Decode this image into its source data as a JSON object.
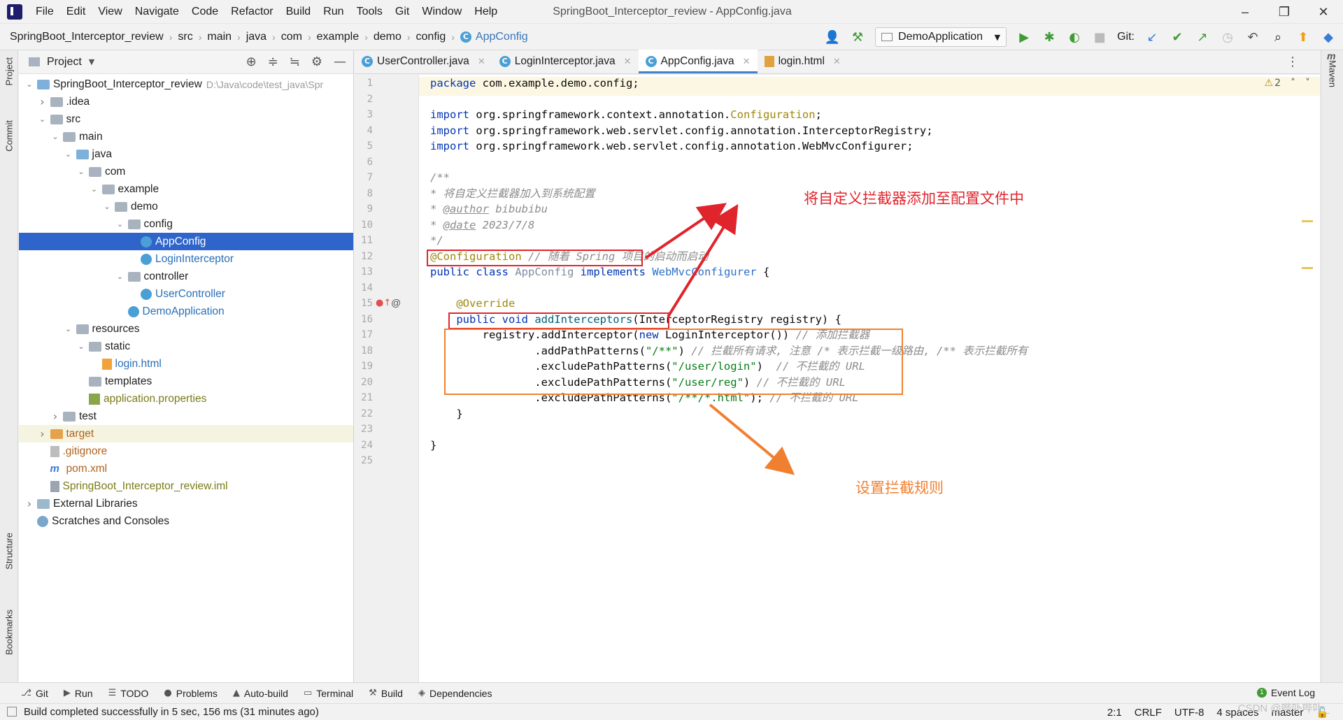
{
  "menubar": {
    "items": [
      "File",
      "Edit",
      "View",
      "Navigate",
      "Code",
      "Refactor",
      "Build",
      "Run",
      "Tools",
      "Git",
      "Window",
      "Help"
    ],
    "window_title": "SpringBoot_Interceptor_review - AppConfig.java"
  },
  "navbar": {
    "breadcrumb": [
      "SpringBoot_Interceptor_review",
      "src",
      "main",
      "java",
      "com",
      "example",
      "demo",
      "config"
    ],
    "current": "AppConfig",
    "run_config": "DemoApplication",
    "git_label": "Git:"
  },
  "left_strip": {
    "tabs": [
      "Project",
      "Commit",
      "Structure",
      "Bookmarks"
    ]
  },
  "project_panel": {
    "title": "Project",
    "tree": [
      {
        "label": "SpringBoot_Interceptor_review",
        "hint": "D:\\Java\\code\\test_java\\Spr",
        "indent": 0,
        "arrow": "v",
        "icon": "folder-blue",
        "style": "bold"
      },
      {
        "label": ".idea",
        "indent": 1,
        "arrow": ">",
        "icon": "folder",
        "style": ""
      },
      {
        "label": "src",
        "indent": 1,
        "arrow": "v",
        "icon": "folder",
        "style": ""
      },
      {
        "label": "main",
        "indent": 2,
        "arrow": "v",
        "icon": "folder",
        "style": ""
      },
      {
        "label": "java",
        "indent": 3,
        "arrow": "v",
        "icon": "folder-blue",
        "style": ""
      },
      {
        "label": "com",
        "indent": 4,
        "arrow": "v",
        "icon": "folder",
        "style": ""
      },
      {
        "label": "example",
        "indent": 5,
        "arrow": "v",
        "icon": "folder",
        "style": ""
      },
      {
        "label": "demo",
        "indent": 6,
        "arrow": "v",
        "icon": "folder",
        "style": ""
      },
      {
        "label": "config",
        "indent": 7,
        "arrow": "v",
        "icon": "folder",
        "style": ""
      },
      {
        "label": "AppConfig",
        "indent": 8,
        "arrow": "",
        "icon": "class",
        "style": "selected"
      },
      {
        "label": "LoginInterceptor",
        "indent": 8,
        "arrow": "",
        "icon": "class",
        "style": "blue"
      },
      {
        "label": "controller",
        "indent": 7,
        "arrow": "v",
        "icon": "folder",
        "style": ""
      },
      {
        "label": "UserController",
        "indent": 8,
        "arrow": "",
        "icon": "class",
        "style": "blue"
      },
      {
        "label": "DemoApplication",
        "indent": 7,
        "arrow": "",
        "icon": "class",
        "style": "blue"
      },
      {
        "label": "resources",
        "indent": 3,
        "arrow": "v",
        "icon": "folder",
        "style": ""
      },
      {
        "label": "static",
        "indent": 4,
        "arrow": "v",
        "icon": "folder",
        "style": ""
      },
      {
        "label": "login.html",
        "indent": 5,
        "arrow": "",
        "icon": "html",
        "style": "blue"
      },
      {
        "label": "templates",
        "indent": 4,
        "arrow": "",
        "icon": "folder",
        "style": ""
      },
      {
        "label": "application.properties",
        "indent": 4,
        "arrow": "",
        "icon": "prop",
        "style": "olive"
      },
      {
        "label": "test",
        "indent": 2,
        "arrow": ">",
        "icon": "folder",
        "style": ""
      },
      {
        "label": "target",
        "indent": 1,
        "arrow": ">",
        "icon": "folder-orange",
        "style": "orange"
      },
      {
        "label": ".gitignore",
        "indent": 1,
        "arrow": "",
        "icon": "git",
        "style": "orange"
      },
      {
        "label": "pom.xml",
        "indent": 1,
        "arrow": "",
        "icon": "m",
        "style": "orange"
      },
      {
        "label": "SpringBoot_Interceptor_review.iml",
        "indent": 1,
        "arrow": "",
        "icon": "iml",
        "style": "olive"
      },
      {
        "label": "External Libraries",
        "indent": 0,
        "arrow": ">",
        "icon": "lib",
        "style": ""
      },
      {
        "label": "Scratches and Consoles",
        "indent": 0,
        "arrow": "",
        "icon": "scratch",
        "style": ""
      }
    ]
  },
  "editor": {
    "tabs": [
      {
        "label": "UserController.java",
        "icon": "class",
        "active": false
      },
      {
        "label": "LoginInterceptor.java",
        "icon": "class",
        "active": false
      },
      {
        "label": "AppConfig.java",
        "icon": "class",
        "active": true
      },
      {
        "label": "login.html",
        "icon": "html",
        "active": false
      }
    ],
    "warnings": "2",
    "line_numbers": [
      "1",
      "2",
      "3",
      "4",
      "5",
      "6",
      "7",
      "8",
      "9",
      "10",
      "11",
      "12",
      "13",
      "14",
      "15",
      "16",
      "17",
      "18",
      "19",
      "20",
      "21",
      "22",
      "23",
      "24",
      "25"
    ],
    "lines": [
      [
        [
          "kw",
          "package "
        ],
        [
          "plain",
          "com.example.demo.config;"
        ]
      ],
      [],
      [
        [
          "kw",
          "import "
        ],
        [
          "plain",
          "org.springframework.context.annotation."
        ],
        [
          "ann",
          "Configuration"
        ],
        [
          "plain",
          ";"
        ]
      ],
      [
        [
          "kw",
          "import "
        ],
        [
          "plain",
          "org.springframework.web.servlet.config.annotation.InterceptorRegistry;"
        ]
      ],
      [
        [
          "kw",
          "import "
        ],
        [
          "plain",
          "org.springframework.web.servlet.config.annotation.WebMvcConfigurer;"
        ]
      ],
      [],
      [
        [
          "cmt",
          "/**"
        ]
      ],
      [
        [
          "cmt",
          "* 将自定义拦截器加入到系统配置"
        ]
      ],
      [
        [
          "cmt",
          "* "
        ],
        [
          "tag",
          "@author"
        ],
        [
          "cmt",
          " bibubibu"
        ]
      ],
      [
        [
          "cmt",
          "* "
        ],
        [
          "tag",
          "@date"
        ],
        [
          "cmt",
          " 2023/7/8"
        ]
      ],
      [
        [
          "cmt",
          "*/"
        ]
      ],
      [
        [
          "ann",
          "@Configuration"
        ],
        [
          "cmt",
          " // 随着 Spring 项目的启动而启动"
        ]
      ],
      [
        [
          "kw",
          "public class "
        ],
        [
          "muted-id",
          "AppConfig "
        ],
        [
          "kw",
          "implements "
        ],
        [
          "iface",
          "WebMvcConfigurer"
        ],
        [
          "plain",
          " {"
        ]
      ],
      [],
      [
        [
          "ann",
          "    @Override"
        ]
      ],
      [
        [
          "kw",
          "    public void "
        ],
        [
          "fn",
          "addInterceptors"
        ],
        [
          "plain",
          "(InterceptorRegistry registry) {"
        ]
      ],
      [
        [
          "plain",
          "        registry."
        ],
        [
          "plain",
          "addInterceptor("
        ],
        [
          "kw",
          "new "
        ],
        [
          "plain",
          "LoginInterceptor())"
        ],
        [
          "cmt",
          " // 添加拦截器"
        ]
      ],
      [
        [
          "plain",
          "                .addPathPatterns("
        ],
        [
          "str",
          "\"/**\""
        ],
        [
          "plain",
          ") "
        ],
        [
          "cmt",
          "// 拦截所有请求, 注意 /* 表示拦截一级路由, /** 表示拦截所有"
        ]
      ],
      [
        [
          "plain",
          "                .excludePathPatterns("
        ],
        [
          "str",
          "\"/user/login\""
        ],
        [
          "plain",
          ")  "
        ],
        [
          "cmt",
          "// 不拦截的 URL"
        ]
      ],
      [
        [
          "plain",
          "                .excludePathPatterns("
        ],
        [
          "str",
          "\"/user/reg\""
        ],
        [
          "plain",
          ") "
        ],
        [
          "cmt",
          "// 不拦截的 URL"
        ]
      ],
      [
        [
          "plain",
          "                .excludePathPatterns("
        ],
        [
          "str",
          "\"/**/*.html\""
        ],
        [
          "plain",
          "); "
        ],
        [
          "cmt",
          "// 不拦截的 URL"
        ]
      ],
      [
        [
          "plain",
          "    }"
        ]
      ],
      [],
      [
        [
          "plain",
          "}"
        ]
      ],
      []
    ]
  },
  "annotations": {
    "red_text": "将自定义拦截器添加至配置文件中",
    "orange_text": "设置拦截规则",
    "red_color": "#e0242c",
    "orange_color": "#f08030"
  },
  "right_strip": {
    "tabs": [
      "Maven"
    ]
  },
  "bottom_tools": [
    "Git",
    "Run",
    "TODO",
    "Problems",
    "Auto-build",
    "Terminal",
    "Build",
    "Dependencies"
  ],
  "event_log": "Event Log",
  "statusbar": {
    "message": "Build completed successfully in 5 sec, 156 ms (31 minutes ago)",
    "position": "2:1",
    "line_sep": "CRLF",
    "encoding": "UTF-8",
    "indent": "4 spaces",
    "branch": "master"
  },
  "watermark": "CSDN @哔卟哔卟_"
}
